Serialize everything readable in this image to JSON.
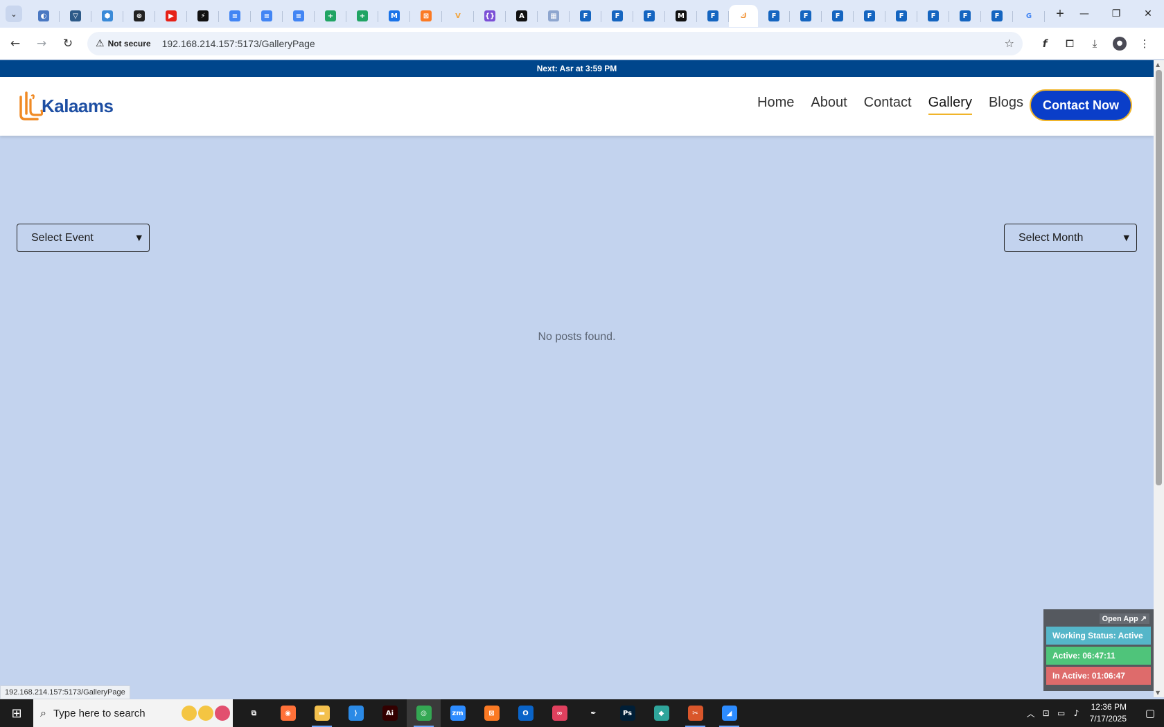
{
  "browser": {
    "tabs": [
      {
        "icon": "globe-blue-icon",
        "color": "#4a78c2",
        "glyph": "◐"
      },
      {
        "icon": "proton-vpn-icon",
        "color": "#2d5a88",
        "glyph": "▽"
      },
      {
        "icon": "hexagon-blue-icon",
        "color": "#3a8ad8",
        "glyph": "⬢"
      },
      {
        "icon": "openai-icon",
        "color": "#222222",
        "glyph": "⊛"
      },
      {
        "icon": "youtube-icon",
        "color": "#e62117",
        "glyph": "▶"
      },
      {
        "icon": "lightning-icon",
        "color": "#111111",
        "glyph": "⚡"
      },
      {
        "icon": "google-docs-icon",
        "color": "#4285f4",
        "glyph": "≡"
      },
      {
        "icon": "google-docs-icon",
        "color": "#4285f4",
        "glyph": "≡"
      },
      {
        "icon": "google-docs-icon",
        "color": "#4285f4",
        "glyph": "≡"
      },
      {
        "icon": "google-sheets-icon",
        "color": "#21a464",
        "glyph": "+"
      },
      {
        "icon": "google-sheets-icon",
        "color": "#21a464",
        "glyph": "+"
      },
      {
        "icon": "mq-icon",
        "color": "#1a73e8",
        "glyph": "M"
      },
      {
        "icon": "xampp-icon",
        "color": "#fb7a24",
        "glyph": "⊠"
      },
      {
        "icon": "vite-icon",
        "color": "#f2a33a",
        "glyph": "V"
      },
      {
        "icon": "json-braces-icon",
        "color": "#7b4fd6",
        "glyph": "{}"
      },
      {
        "icon": "notion-like-icon",
        "color": "#111111",
        "glyph": "A"
      },
      {
        "icon": "grid-icon",
        "color": "#8ea6cf",
        "glyph": "▦"
      },
      {
        "icon": "forms-icon",
        "color": "#1565c0",
        "glyph": "F"
      },
      {
        "icon": "forms-icon",
        "color": "#1565c0",
        "glyph": "F"
      },
      {
        "icon": "forms-icon",
        "color": "#1565c0",
        "glyph": "F"
      },
      {
        "icon": "medium-icon",
        "color": "#111111",
        "glyph": "M"
      },
      {
        "icon": "forms-icon",
        "color": "#1565c0",
        "glyph": "F"
      },
      {
        "icon": "kalaams-icon",
        "color": "#f08a24",
        "glyph": "ك",
        "active": true
      },
      {
        "icon": "forms-icon",
        "color": "#1565c0",
        "glyph": "F"
      },
      {
        "icon": "forms-icon",
        "color": "#1565c0",
        "glyph": "F"
      },
      {
        "icon": "forms-icon",
        "color": "#1565c0",
        "glyph": "F"
      },
      {
        "icon": "forms-icon",
        "color": "#1565c0",
        "glyph": "F"
      },
      {
        "icon": "forms-icon",
        "color": "#1565c0",
        "glyph": "F"
      },
      {
        "icon": "forms-icon",
        "color": "#1565c0",
        "glyph": "F"
      },
      {
        "icon": "forms-icon",
        "color": "#1565c0",
        "glyph": "F"
      },
      {
        "icon": "forms-icon",
        "color": "#1565c0",
        "glyph": "F"
      },
      {
        "icon": "google-icon",
        "color": "#ffffff",
        "glyph": "G"
      }
    ],
    "security_label": "Not secure",
    "url": "192.168.214.157:5173/GalleryPage"
  },
  "site": {
    "prayer_bar": "Next: Asr at 3:59 PM",
    "logo_text": "Kalaams",
    "nav": [
      {
        "label": "Home",
        "current": false
      },
      {
        "label": "About",
        "current": false
      },
      {
        "label": "Contact",
        "current": false
      },
      {
        "label": "Gallery",
        "current": true
      },
      {
        "label": "Blogs",
        "current": false
      }
    ],
    "cta_label": "Contact Now",
    "event_filter": "Select Event",
    "month_filter": "Select Month",
    "empty_message": "No posts found.",
    "accent_color": "#f0b429",
    "brand_color": "#0a3ec9"
  },
  "status_url": "192.168.214.157:5173/GalleryPage",
  "tracker": {
    "open_label": "Open App ↗",
    "working_status": "Working Status: Active",
    "active_time": "Active: 06:47:11",
    "inactive_time": "In Active: 01:06:47"
  },
  "taskbar": {
    "search_placeholder": "Type here to search",
    "apps": [
      {
        "icon": "task-view-icon",
        "color": "#1c1c1c",
        "glyph": "⧉",
        "running": false
      },
      {
        "icon": "firefox-icon",
        "color": "#ff7139",
        "glyph": "◉",
        "running": false
      },
      {
        "icon": "file-explorer-icon",
        "color": "#f3c04d",
        "glyph": "▬",
        "running": true
      },
      {
        "icon": "vscode-icon",
        "color": "#2b8ae6",
        "glyph": "⟩",
        "running": false
      },
      {
        "icon": "illustrator-icon",
        "color": "#330000",
        "glyph": "Ai",
        "running": false
      },
      {
        "icon": "chrome-icon",
        "color": "#34a853",
        "glyph": "◎",
        "running": true,
        "focused": true
      },
      {
        "icon": "zoom-icon",
        "color": "#2d8cff",
        "glyph": "zm",
        "running": false
      },
      {
        "icon": "xampp-icon",
        "color": "#fb7a24",
        "glyph": "⊠",
        "running": false
      },
      {
        "icon": "outlook-icon",
        "color": "#0a64c8",
        "glyph": "O",
        "running": false
      },
      {
        "icon": "creative-cloud-icon",
        "color": "#e0405e",
        "glyph": "∞",
        "running": false
      },
      {
        "icon": "pen-tool-icon",
        "color": "#1c1c1c",
        "glyph": "✒",
        "running": false
      },
      {
        "icon": "photoshop-icon",
        "color": "#001e36",
        "glyph": "Ps",
        "running": false
      },
      {
        "icon": "crystal-icon",
        "color": "#2fa59b",
        "glyph": "◆",
        "running": false
      },
      {
        "icon": "snipping-tool-icon",
        "color": "#d9562b",
        "glyph": "✂",
        "running": true
      },
      {
        "icon": "paint-icon",
        "color": "#2d8cff",
        "glyph": "◢",
        "running": true
      }
    ],
    "time": "12:36 PM",
    "date": "7/17/2025"
  }
}
